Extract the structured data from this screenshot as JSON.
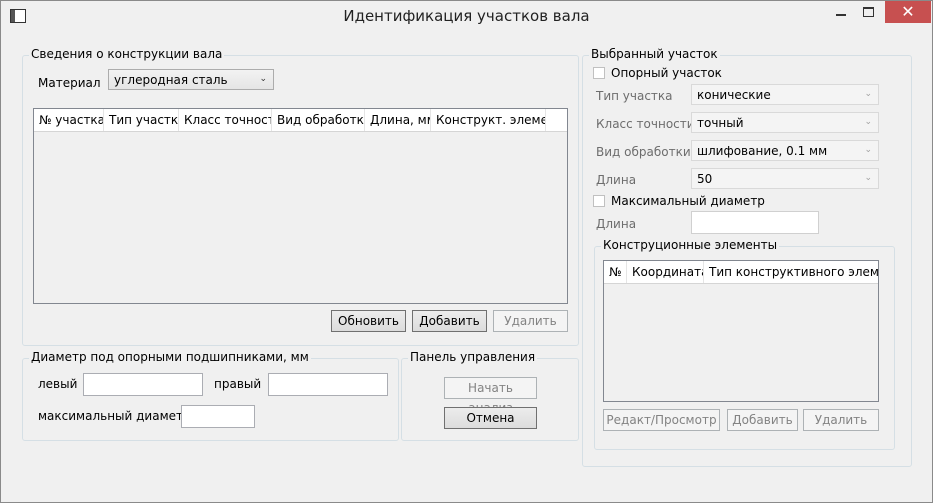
{
  "window": {
    "title": "Идентификация участков вала",
    "close_glyph": "✕"
  },
  "shaft_info": {
    "group_title": "Сведения о конструкции вала",
    "material_label": "Материал",
    "material_value": "углеродная сталь",
    "table_columns": [
      "№ участка",
      "Тип участка",
      "Класс точности",
      "Вид обработки",
      "Длина, мм",
      "Конструкт. элемент"
    ],
    "update_button": "Обновить",
    "add_button": "Добавить",
    "delete_button": "Удалить"
  },
  "bearing_diameter": {
    "group_title": "Диаметр под опорными подшипниками, мм",
    "left_label": "левый",
    "right_label": "правый",
    "left_value": "",
    "right_value": "",
    "max_diameter_label": "максимальный диаметр",
    "max_diameter_value": ""
  },
  "control_panel": {
    "group_title": "Панель управления",
    "start_button": "Начать анализ",
    "cancel_button": "Отмена"
  },
  "selected_section": {
    "group_title": "Выбранный участок",
    "support_checkbox_label": "Опорный участок",
    "type_label": "Тип участка",
    "type_value": "конические",
    "accuracy_label": "Класс точности",
    "accuracy_value": "точный",
    "processing_label": "Вид обработки",
    "processing_value": "шлифование, 0.1 мм",
    "length_label": "Длина",
    "length_value": "50",
    "max_diameter_checkbox_label": "Максимальный диаметр",
    "length2_label": "Длина",
    "length2_value": ""
  },
  "constructive_elements": {
    "group_title": "Конструционные элементы",
    "columns": [
      "№",
      "Координата",
      "Тип конструктивного элемента"
    ],
    "edit_button": "Редакт/Просмотр",
    "add_button": "Добавить",
    "delete_button": "Удалить"
  },
  "icons": {
    "app": "window-icon",
    "minimize": "minimize-icon",
    "maximize": "maximize-icon",
    "close": "close-icon",
    "dropdown": "chevron-down-icon"
  },
  "colors": {
    "close_button": "#c75050",
    "background": "#f0f0f0"
  }
}
